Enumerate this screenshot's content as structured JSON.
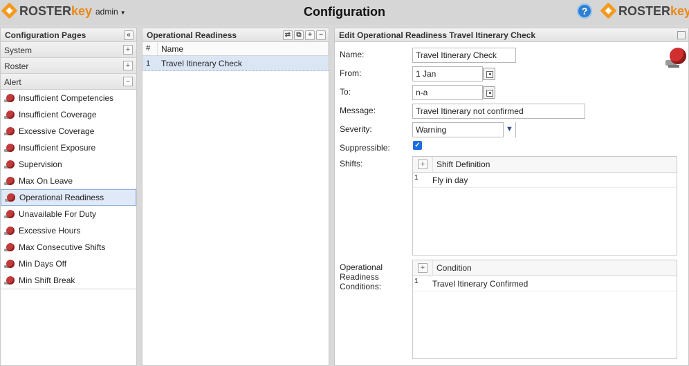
{
  "header": {
    "brand_part1": "ROSTER",
    "brand_part2": "key",
    "user": "admin",
    "title": "Configuration",
    "help_symbol": "?"
  },
  "left_panel": {
    "title": "Configuration Pages",
    "collapse_symbol": "«",
    "sections": [
      {
        "label": "System",
        "toggle": "+"
      },
      {
        "label": "Roster",
        "toggle": "+"
      },
      {
        "label": "Alert",
        "toggle": "−"
      }
    ],
    "alert_items": [
      {
        "label": "Insufficient Competencies"
      },
      {
        "label": "Insufficient Coverage"
      },
      {
        "label": "Excessive Coverage"
      },
      {
        "label": "Insufficient Exposure"
      },
      {
        "label": "Supervision"
      },
      {
        "label": "Max On Leave"
      },
      {
        "label": "Operational Readiness",
        "selected": true
      },
      {
        "label": "Unavailable For Duty"
      },
      {
        "label": "Excessive Hours"
      },
      {
        "label": "Max Consecutive Shifts"
      },
      {
        "label": "Min Days Off"
      },
      {
        "label": "Min Shift Break"
      }
    ]
  },
  "middle_panel": {
    "title": "Operational Readiness",
    "buttons": [
      "⇄",
      "⧉",
      "+",
      "−"
    ],
    "columns": [
      "#",
      "Name"
    ],
    "rows": [
      {
        "num": "1",
        "name": "Travel Itinerary Check"
      }
    ]
  },
  "right_panel": {
    "title": "Edit Operational Readiness Travel Itinerary Check",
    "name_label": "Name:",
    "name_value": "Travel Itinerary Check",
    "from_label": "From:",
    "from_value": "1 Jan",
    "to_label": "To:",
    "to_value": "n-a",
    "message_label": "Message:",
    "message_value": "Travel Itinerary not confirmed",
    "severity_label": "Severity:",
    "severity_value": "Warning",
    "suppressible_label": "Suppressible:",
    "suppressible_checked": "✓",
    "shifts_label": "Shifts:",
    "shifts_column": "Shift Definition",
    "shifts_rows": [
      {
        "num": "1",
        "value": "Fly in day"
      }
    ],
    "conditions_label_1": "Operational",
    "conditions_label_2": "Readiness",
    "conditions_label_3": "Conditions:",
    "conditions_column": "Condition",
    "conditions_rows": [
      {
        "num": "1",
        "value": "Travel Itinerary Confirmed"
      }
    ],
    "add_symbol": "+"
  },
  "colors": {
    "accent_orange": "#f39a1e",
    "selected_row": "#dbe6f5",
    "alert_red": "#c23b3b",
    "help_blue": "#2f7fd0"
  }
}
